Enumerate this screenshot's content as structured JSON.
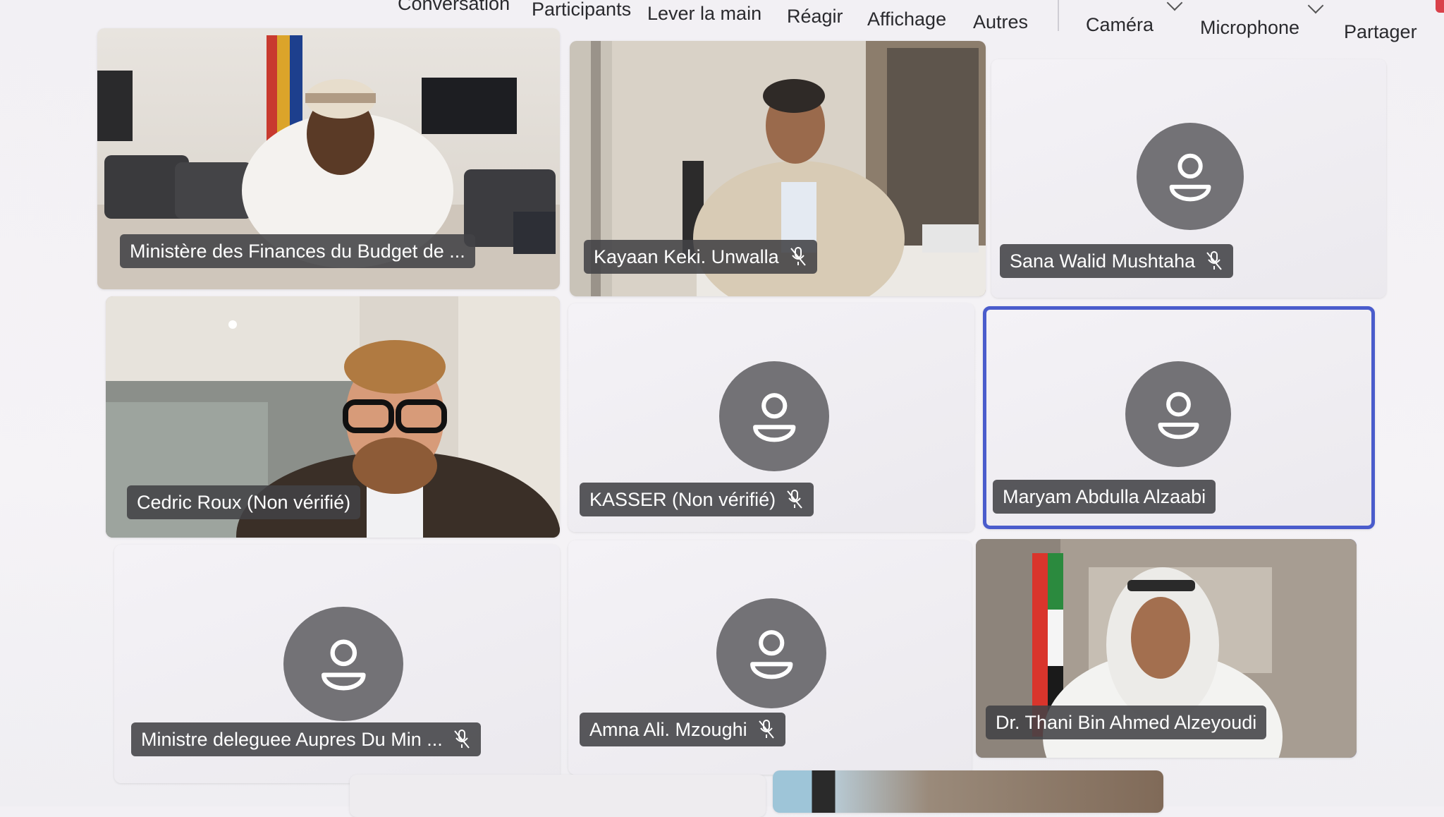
{
  "toolbar": {
    "items": [
      {
        "label": "Conversation",
        "icon": "chat-icon"
      },
      {
        "label": "Participants",
        "icon": "people-icon"
      },
      {
        "label": "Lever la main",
        "icon": "hand-icon"
      },
      {
        "label": "Réagir",
        "icon": "emoji-icon"
      },
      {
        "label": "Affichage",
        "icon": "grid-icon"
      },
      {
        "label": "Autres",
        "icon": "more-icon"
      },
      {
        "label": "Caméra",
        "icon": "camera-icon"
      },
      {
        "label": "Microphone",
        "icon": "microphone-icon"
      },
      {
        "label": "Partager",
        "icon": "share-icon"
      }
    ]
  },
  "participants": [
    {
      "name": "Ministère des Finances du Budget de ...",
      "video": true,
      "muted": false,
      "speaking": false
    },
    {
      "name": "Kayaan Keki. Unwalla",
      "video": true,
      "muted": true,
      "speaking": false
    },
    {
      "name": "Sana Walid Mushtaha",
      "video": false,
      "muted": true,
      "speaking": false
    },
    {
      "name": "Cedric Roux (Non vérifié)",
      "video": true,
      "muted": false,
      "speaking": false
    },
    {
      "name": "KASSER (Non vérifié)",
      "video": false,
      "muted": true,
      "speaking": false
    },
    {
      "name": "Maryam Abdulla Alzaabi",
      "video": false,
      "muted": false,
      "speaking": true
    },
    {
      "name": "Ministre deleguee Aupres Du Min ...",
      "video": false,
      "muted": true,
      "speaking": false
    },
    {
      "name": "Amna Ali. Mzoughi",
      "video": false,
      "muted": true,
      "speaking": false
    },
    {
      "name": "Dr. Thani Bin Ahmed Alzeyoudi",
      "video": true,
      "muted": false,
      "speaking": true
    }
  ],
  "colors": {
    "speaking_outline": "#4a5ccc",
    "avatar_bg": "#737276",
    "nametag_bg": "#424246"
  }
}
